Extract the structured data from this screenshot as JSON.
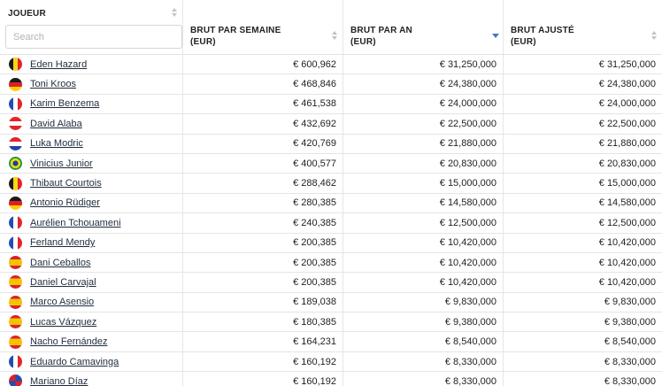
{
  "header": {
    "col_player": "JOUEUR",
    "search_placeholder": "Search",
    "col_week": "BRUT PAR SEMAINE",
    "col_week_unit": "(EUR)",
    "col_year": "BRUT PAR AN",
    "col_year_unit": "(EUR)",
    "col_adj": "BRUT AJUSTÉ",
    "col_adj_unit": "(EUR)"
  },
  "rows": [
    {
      "name": "Eden Hazard",
      "flag": "belgium",
      "week": "€ 600,962",
      "year": "€ 31,250,000",
      "adj": "€ 31,250,000"
    },
    {
      "name": "Toni Kroos",
      "flag": "germany",
      "week": "€ 468,846",
      "year": "€ 24,380,000",
      "adj": "€ 24,380,000"
    },
    {
      "name": "Karim Benzema",
      "flag": "france",
      "week": "€ 461,538",
      "year": "€ 24,000,000",
      "adj": "€ 24,000,000"
    },
    {
      "name": "David Alaba",
      "flag": "austria",
      "week": "€ 432,692",
      "year": "€ 22,500,000",
      "adj": "€ 22,500,000"
    },
    {
      "name": "Luka Modric",
      "flag": "croatia",
      "week": "€ 420,769",
      "year": "€ 21,880,000",
      "adj": "€ 21,880,000"
    },
    {
      "name": "Vinicius Junior",
      "flag": "brazil",
      "week": "€ 400,577",
      "year": "€ 20,830,000",
      "adj": "€ 20,830,000"
    },
    {
      "name": "Thibaut Courtois",
      "flag": "belgium",
      "week": "€ 288,462",
      "year": "€ 15,000,000",
      "adj": "€ 15,000,000"
    },
    {
      "name": "Antonio Rüdiger",
      "flag": "germany",
      "week": "€ 280,385",
      "year": "€ 14,580,000",
      "adj": "€ 14,580,000"
    },
    {
      "name": "Aurélien Tchouameni",
      "flag": "france",
      "week": "€ 240,385",
      "year": "€ 12,500,000",
      "adj": "€ 12,500,000"
    },
    {
      "name": "Ferland Mendy",
      "flag": "france",
      "week": "€ 200,385",
      "year": "€ 10,420,000",
      "adj": "€ 10,420,000"
    },
    {
      "name": "Dani Ceballos",
      "flag": "spain",
      "week": "€ 200,385",
      "year": "€ 10,420,000",
      "adj": "€ 10,420,000"
    },
    {
      "name": "Daniel Carvajal",
      "flag": "spain",
      "week": "€ 200,385",
      "year": "€ 10,420,000",
      "adj": "€ 10,420,000"
    },
    {
      "name": "Marco Asensio",
      "flag": "spain",
      "week": "€ 189,038",
      "year": "€ 9,830,000",
      "adj": "€ 9,830,000"
    },
    {
      "name": "Lucas Vázquez",
      "flag": "spain",
      "week": "€ 180,385",
      "year": "€ 9,380,000",
      "adj": "€ 9,380,000"
    },
    {
      "name": "Nacho Fernández",
      "flag": "spain",
      "week": "€ 164,231",
      "year": "€ 8,540,000",
      "adj": "€ 8,540,000"
    },
    {
      "name": "Eduardo Camavinga",
      "flag": "france",
      "week": "€ 160,192",
      "year": "€ 8,330,000",
      "adj": "€ 8,330,000"
    },
    {
      "name": "Mariano Díaz",
      "flag": "dominican-republic",
      "week": "€ 160,192",
      "year": "€ 8,330,000",
      "adj": "€ 8,330,000"
    }
  ],
  "flag_styles": {
    "belgium": "linear-gradient(90deg,#1a1a1a 0 33.3%,#f9d616 33.3% 66.6%,#e3242b 66.6%)",
    "germany": "linear-gradient(180deg,#1a1a1a 0 33.3%,#dd1f26 33.3% 66.6%,#ffce00 66.6%)",
    "france": "linear-gradient(90deg,#1f4fb4 0 33.3%,#ffffff 33.3% 66.6%,#e3242b 66.6%)",
    "austria": "linear-gradient(180deg,#e3242b 0 33.3%,#ffffff 33.3% 66.6%,#e3242b 66.6%)",
    "croatia": "linear-gradient(180deg,#e3242b 0 33.3%,#ffffff 33.3% 66.6%,#2342a8 66.6%)",
    "brazil": "radial-gradient(circle,#1d3f9c 0 28%,#f9d616 29% 52%,#1d9a3e 53%)",
    "spain": "linear-gradient(180deg,#d8232a 0 25%,#f7c200 25% 75%,#d8232a 75%)",
    "dominican-republic": "conic-gradient(#1f4fb4 0 25%,#d8232a 25% 50%,#1f4fb4 50% 75%,#d8232a 75%)"
  },
  "sort": {
    "active_column": "BRUT PAR AN",
    "direction": "descending",
    "active_color": "#4a72c9"
  }
}
